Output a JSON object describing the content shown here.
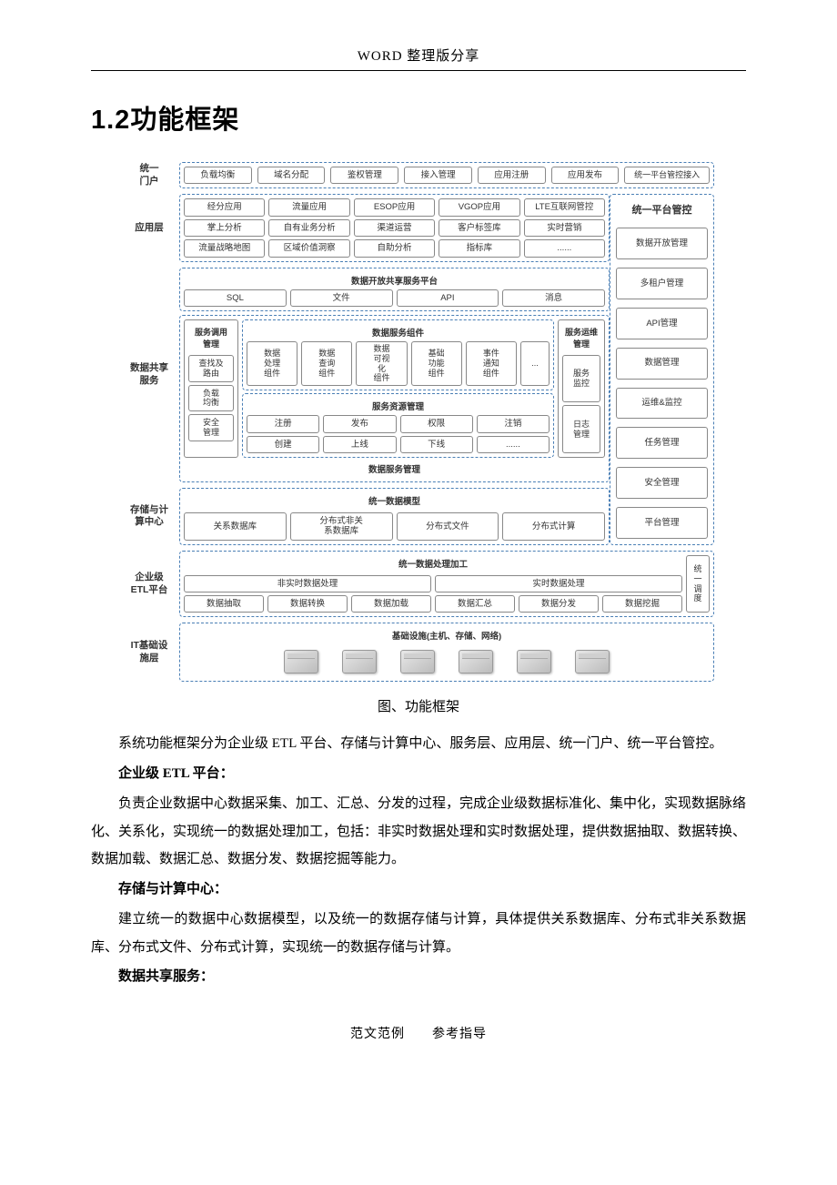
{
  "header": "WORD 整理版分享",
  "section_number": "1.2",
  "section_title": "功能框架",
  "diagram": {
    "labels": {
      "portal": "统一\n门户",
      "app": "应用层",
      "share": "数据共享\n服务",
      "storage": "存储与计\n算中心",
      "etl": "企业级\nETL平台",
      "it": "IT基础设\n施层"
    },
    "portal_row": [
      "负载均衡",
      "域名分配",
      "鉴权管理",
      "接入管理",
      "应用注册",
      "应用发布",
      "统一平台管控接入"
    ],
    "app_rows": [
      [
        "经分应用",
        "流量应用",
        "ESOP应用",
        "VGOP应用",
        "LTE互联网管控"
      ],
      [
        "掌上分析",
        "自有业务分析",
        "渠道运营",
        "客户标签库",
        "实时营销"
      ],
      [
        "流量战略地图",
        "区域价值洞察",
        "自助分析",
        "指标库",
        "......"
      ]
    ],
    "right_panel_title": "统一平台管控",
    "right_panel_items": [
      "数据开放管理",
      "多租户管理",
      "API管理",
      "数据管理",
      "运维&监控",
      "任务管理",
      "安全管理",
      "平台管理"
    ],
    "open_platform": {
      "title": "数据开放共享服务平台",
      "items": [
        "SQL",
        "文件",
        "API",
        "消息"
      ]
    },
    "svc_call": {
      "title": "服务调用\n管理",
      "items": [
        "查找及\n路由",
        "负载\n均衡",
        "安全\n管理"
      ]
    },
    "svc_comp": {
      "title": "数据服务组件",
      "items": [
        "数据\n处理\n组件",
        "数据\n查询\n组件",
        "数据\n可视\n化\n组件",
        "基础\n功能\n组件",
        "事件\n通知\n组件",
        "..."
      ]
    },
    "svc_res": {
      "title": "服务资源管理",
      "row1": [
        "注册",
        "发布",
        "权限",
        "注销"
      ],
      "row2": [
        "创建",
        "上线",
        "下线",
        "......"
      ]
    },
    "svc_ops": {
      "title": "服务运维\n管理",
      "items": [
        "服务\n监控",
        "日志\n管理"
      ]
    },
    "svc_mgmt_title": "数据服务管理",
    "storage": {
      "title": "统一数据模型",
      "items": [
        "关系数据库",
        "分布式非关\n系数据库",
        "分布式文件",
        "分布式计算"
      ]
    },
    "etl_block": {
      "title": "统一数据处理加工",
      "row1": [
        "非实时数据处理",
        "实时数据处理"
      ],
      "row2": [
        "数据抽取",
        "数据转换",
        "数据加载",
        "数据汇总",
        "数据分发",
        "数据挖掘"
      ],
      "side": "统\n一\n调\n度"
    },
    "it_title": "基础设施(主机、存储、网络)"
  },
  "caption": "图、功能框架",
  "paragraphs": {
    "p1": "系统功能框架分为企业级 ETL 平台、存储与计算中心、服务层、应用层、统一门户、统一平台管控。",
    "h1": "企业级 ETL 平台：",
    "p2": "负责企业数据中心数据采集、加工、汇总、分发的过程，完成企业级数据标准化、集中化，实现数据脉络化、关系化，实现统一的数据处理加工，包括：非实时数据处理和实时数据处理，提供数据抽取、数据转换、数据加载、数据汇总、数据分发、数据挖掘等能力。",
    "h2": "存储与计算中心：",
    "p3": "建立统一的数据中心数据模型，以及统一的数据存储与计算，具体提供关系数据库、分布式非关系数据库、分布式文件、分布式计算，实现统一的数据存储与计算。",
    "h3": "数据共享服务："
  },
  "footer": "范文范例　　参考指导"
}
